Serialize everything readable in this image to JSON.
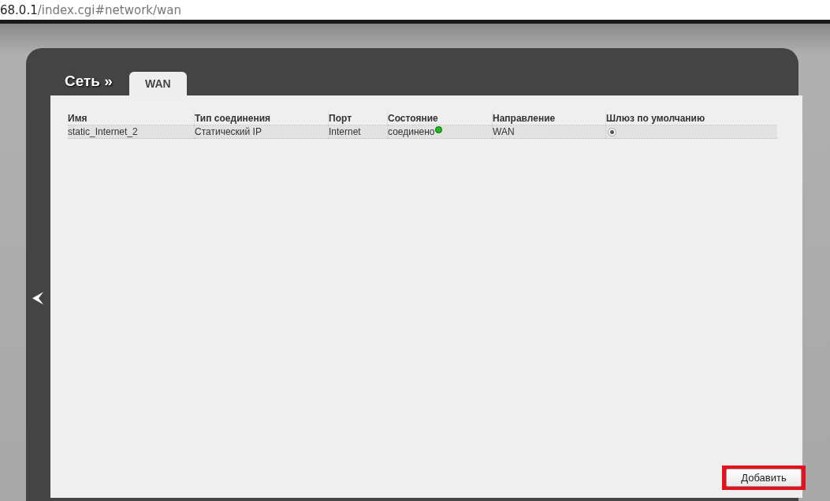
{
  "address_bar": {
    "host": "68.0.1",
    "path": "/index.cgi#network/wan"
  },
  "breadcrumb": "Сеть »",
  "tabs": [
    {
      "label": "WAN",
      "selected": true
    }
  ],
  "table": {
    "columns": [
      "Имя",
      "Тип соединения",
      "Порт",
      "Состояние",
      "Направление",
      "Шлюз по умолчанию"
    ],
    "rows": [
      {
        "name": "static_Internet_2",
        "type": "Статический IP",
        "port": "Internet",
        "status": "соединено",
        "color": "#22bb22",
        "direction": "WAN",
        "default_gateway": true
      }
    ]
  },
  "add_button": {
    "label": "Добавить",
    "highlighted": true
  }
}
